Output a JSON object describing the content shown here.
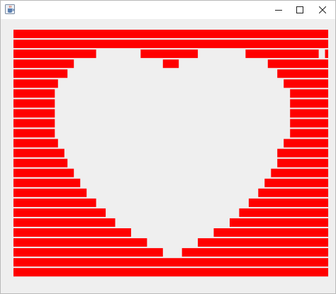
{
  "window": {
    "icons": {
      "app": "java-cup-icon",
      "minimize": "minimize-icon",
      "maximize": "maximize-icon",
      "close": "close-icon"
    }
  },
  "graphic": {
    "bar_color": "#ff0000",
    "background_color": "#efefef",
    "rows": [
      [
        [
          1,
          100
        ]
      ],
      [
        [
          1,
          100
        ]
      ],
      [
        [
          1,
          27
        ],
        [
          41,
          59
        ],
        [
          74,
          97
        ],
        [
          99,
          100
        ]
      ],
      [
        [
          1,
          20
        ],
        [
          48,
          53
        ],
        [
          81,
          100
        ]
      ],
      [
        [
          1,
          18
        ],
        [
          84,
          100
        ]
      ],
      [
        [
          1,
          15
        ],
        [
          86,
          100
        ]
      ],
      [
        [
          1,
          14
        ],
        [
          88,
          100
        ]
      ],
      [
        [
          1,
          14
        ],
        [
          88,
          100
        ]
      ],
      [
        [
          1,
          14
        ],
        [
          88,
          100
        ]
      ],
      [
        [
          1,
          14
        ],
        [
          88,
          100
        ]
      ],
      [
        [
          1,
          14
        ],
        [
          88,
          100
        ]
      ],
      [
        [
          1,
          15
        ],
        [
          86,
          100
        ]
      ],
      [
        [
          1,
          17
        ],
        [
          84,
          100
        ]
      ],
      [
        [
          1,
          18
        ],
        [
          84,
          100
        ]
      ],
      [
        [
          1,
          20
        ],
        [
          82,
          100
        ]
      ],
      [
        [
          1,
          22
        ],
        [
          80,
          100
        ]
      ],
      [
        [
          1,
          24
        ],
        [
          78,
          100
        ]
      ],
      [
        [
          1,
          27
        ],
        [
          75,
          100
        ]
      ],
      [
        [
          1,
          30
        ],
        [
          72,
          100
        ]
      ],
      [
        [
          1,
          33
        ],
        [
          69,
          100
        ]
      ],
      [
        [
          1,
          38
        ],
        [
          64,
          100
        ]
      ],
      [
        [
          1,
          43
        ],
        [
          59,
          100
        ]
      ],
      [
        [
          1,
          48
        ],
        [
          54,
          100
        ]
      ],
      [
        [
          1,
          100
        ]
      ],
      [
        [
          1,
          100
        ]
      ]
    ]
  }
}
